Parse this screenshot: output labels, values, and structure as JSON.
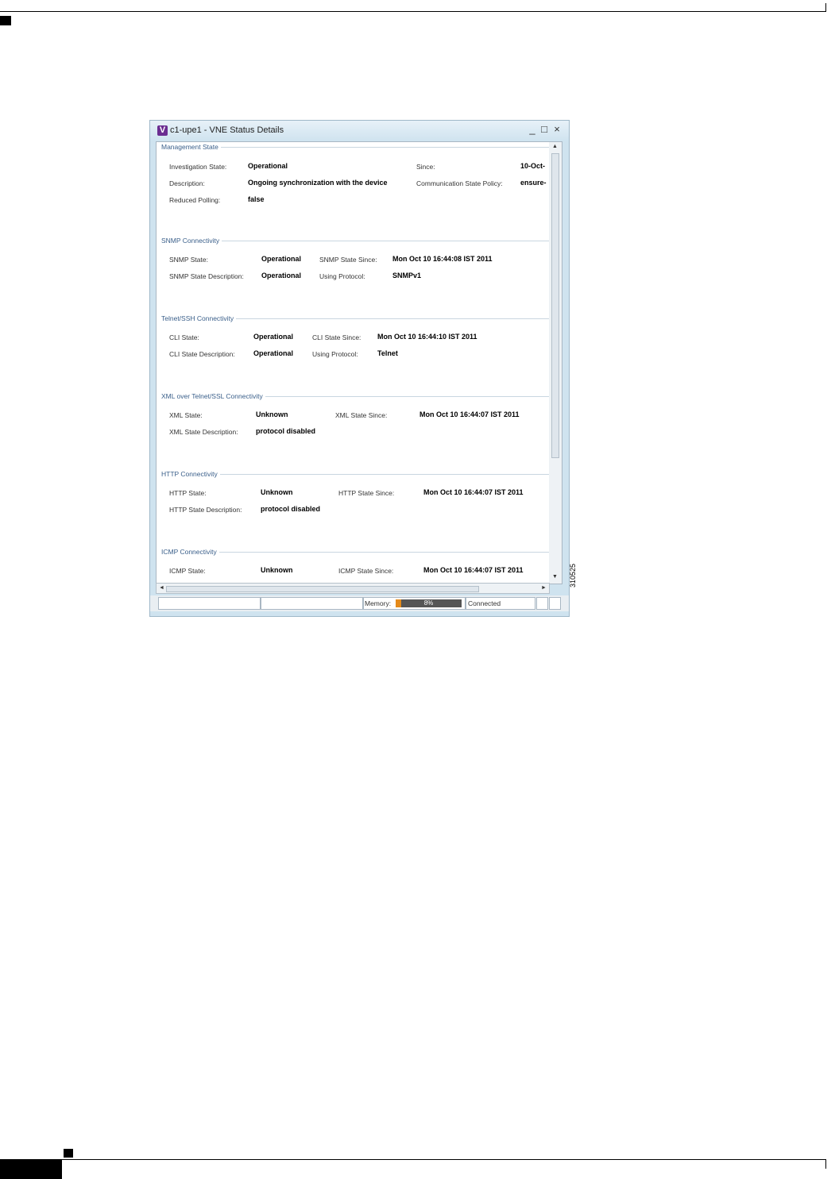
{
  "window": {
    "icon_letter": "V",
    "title": "c1-upe1  - VNE Status Details",
    "minimize": "_",
    "maximize": "□",
    "close": "×"
  },
  "sections": {
    "management": {
      "title": "Management State",
      "investigation_state_label": "Investigation State:",
      "investigation_state_value": "Operational",
      "since_label": "Since:",
      "since_value": "10-Oct-",
      "description_label": "Description:",
      "description_value": "Ongoing synchronization with the device",
      "comm_policy_label": "Communication State Policy:",
      "comm_policy_value": "ensure-",
      "reduced_polling_label": "Reduced Polling:",
      "reduced_polling_value": "false"
    },
    "snmp": {
      "title": "SNMP Connectivity",
      "state_label": "SNMP State:",
      "state_value": "Operational",
      "since_label": "SNMP State Since:",
      "since_value": "Mon Oct 10 16:44:08 IST 2011",
      "desc_label": "SNMP State Description:",
      "desc_value": "Operational",
      "protocol_label": "Using Protocol:",
      "protocol_value": "SNMPv1"
    },
    "telnet": {
      "title": "Telnet/SSH Connectivity",
      "state_label": "CLI State:",
      "state_value": "Operational",
      "since_label": "CLI State Since:",
      "since_value": "Mon Oct 10 16:44:10 IST 2011",
      "desc_label": "CLI State Description:",
      "desc_value": "Operational",
      "protocol_label": "Using Protocol:",
      "protocol_value": "Telnet"
    },
    "xml": {
      "title": "XML over Telnet/SSL Connectivity",
      "state_label": "XML State:",
      "state_value": "Unknown",
      "since_label": "XML State Since:",
      "since_value": "Mon Oct 10 16:44:07 IST 2011",
      "desc_label": "XML State Description:",
      "desc_value": "protocol disabled"
    },
    "http": {
      "title": "HTTP Connectivity",
      "state_label": "HTTP State:",
      "state_value": "Unknown",
      "since_label": "HTTP State Since:",
      "since_value": "Mon Oct 10 16:44:07 IST 2011",
      "desc_label": "HTTP State Description:",
      "desc_value": "protocol disabled"
    },
    "icmp": {
      "title": "ICMP Connectivity",
      "state_label": "ICMP State:",
      "state_value": "Unknown",
      "since_label": "ICMP State Since:",
      "since_value": "Mon Oct 10 16:44:07 IST 2011"
    }
  },
  "statusbar": {
    "memory_label": "Memory:",
    "memory_value": "8%",
    "memory_fraction": 0.08,
    "connection": "Connected"
  },
  "figure_id": "310525"
}
